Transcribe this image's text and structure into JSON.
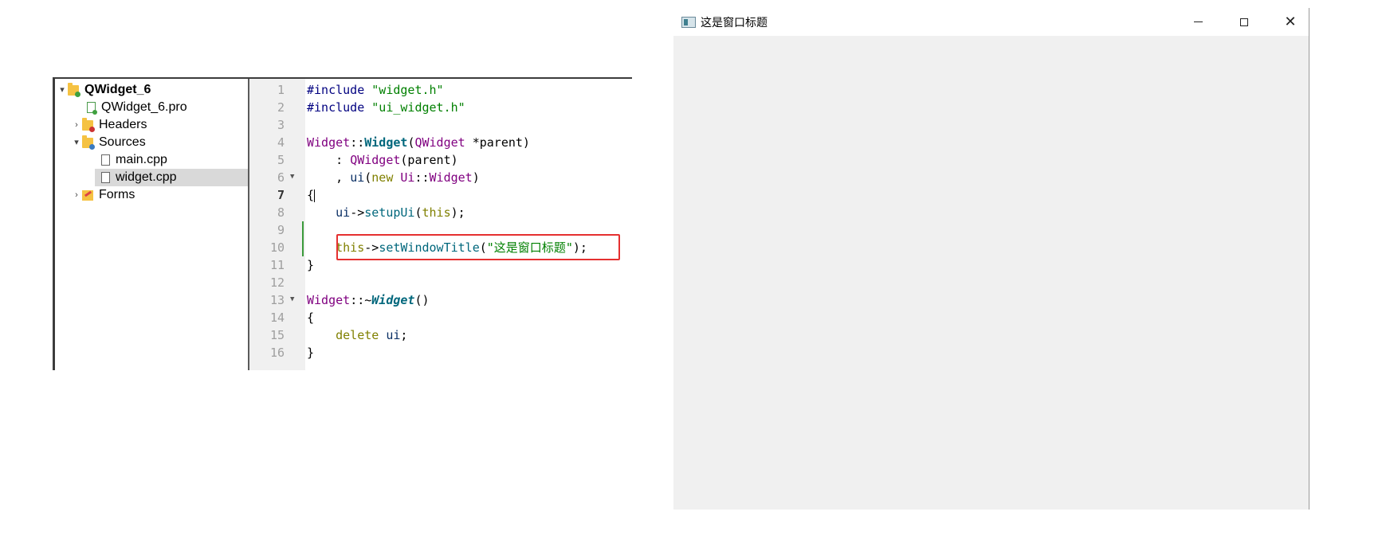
{
  "project_tree": {
    "project": "QWidget_6",
    "pro_file": "QWidget_6.pro",
    "headers": "Headers",
    "sources": "Sources",
    "source_files": [
      "main.cpp",
      "widget.cpp"
    ],
    "forms": "Forms",
    "selected": "widget.cpp"
  },
  "editor": {
    "line_numbers": [
      "1",
      "2",
      "3",
      "4",
      "5",
      "6",
      "7",
      "8",
      "9",
      "10",
      "11",
      "12",
      "13",
      "14",
      "15",
      "16"
    ],
    "current_line": "7",
    "lines": {
      "l1": {
        "pre": "#include",
        "str": "\"widget.h\""
      },
      "l2": {
        "pre": "#include",
        "str": "\"ui_widget.h\""
      },
      "l4": {
        "cls": "Widget",
        "sep": "::",
        "fn": "Widget",
        "open": "(",
        "type": "QWidget",
        "rest": " *parent)"
      },
      "l5": {
        "lead": "    : ",
        "type": "QWidget",
        "rest": "(parent)"
      },
      "l6": {
        "lead": "    , ",
        "var": "ui",
        "open": "(",
        "kw": "new",
        "sp": " ",
        "ns": "Ui",
        "sep": "::",
        "type": "Widget",
        "close": ")"
      },
      "l7": {
        "brace": "{"
      },
      "l8": {
        "lead": "    ",
        "var": "ui",
        "arrow": "->",
        "call": "setupUi",
        "open": "(",
        "kw": "this",
        "close": ");"
      },
      "l10": {
        "lead": "    ",
        "kw": "this",
        "arrow": "->",
        "call": "setWindowTitle",
        "open": "(",
        "str": "\"这是窗口标题\"",
        "close": ");"
      },
      "l11": {
        "brace": "}"
      },
      "l13": {
        "cls": "Widget",
        "sep": "::~",
        "fn": "Widget",
        "rest": "()"
      },
      "l14": {
        "brace": "{"
      },
      "l15": {
        "lead": "    ",
        "kw": "delete",
        "sp": " ",
        "var": "ui",
        "rest": ";"
      },
      "l16": {
        "brace": "}"
      }
    }
  },
  "window": {
    "title": "这是窗口标题",
    "minimize": "minimize",
    "maximize": "maximize",
    "close_glyph": "✕"
  },
  "colors": {
    "highlight_box": "#e53030",
    "client_bg": "#f0f0f0",
    "folder": "#f5c242"
  }
}
